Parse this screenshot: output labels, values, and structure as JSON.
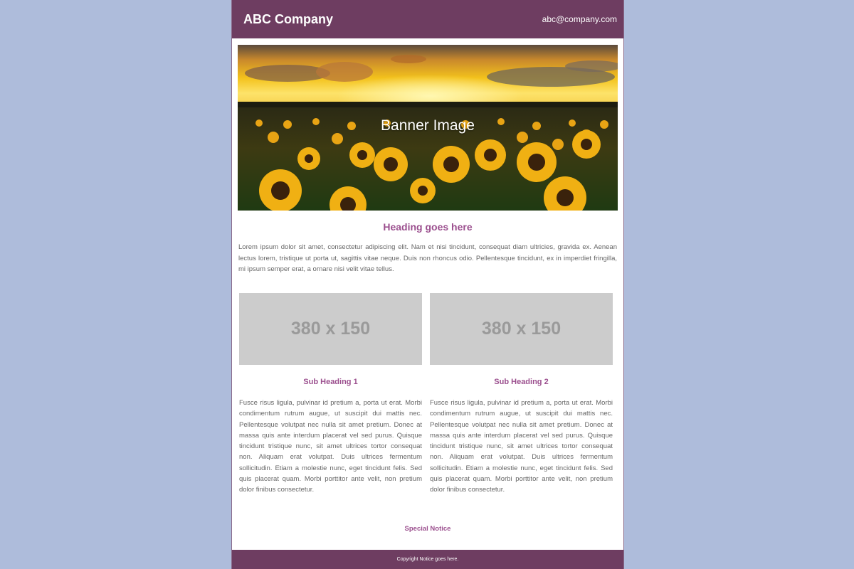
{
  "header": {
    "company": "ABC Company",
    "email": "abc@company.com"
  },
  "banner": {
    "label": "Banner Image"
  },
  "main": {
    "heading": "Heading goes here",
    "intro": "Lorem ipsum dolor sit amet, consectetur adipiscing elit. Nam et nisi tincidunt, consequat diam ultricies, gravida ex. Aenean lectus lorem, tristique ut porta ut, sagittis vitae neque. Duis non rhoncus odio. Pellentesque tincidunt, ex in imperdiet fringilla, mi ipsum semper erat, a ornare nisi velit vitae tellus."
  },
  "columns": [
    {
      "image_text": "380 x 150",
      "subheading": "Sub Heading 1",
      "text": "Fusce risus ligula, pulvinar id pretium a, porta ut erat. Morbi condimentum rutrum augue, ut suscipit dui mattis nec. Pellentesque volutpat nec nulla sit amet pretium. Donec at massa quis ante interdum placerat vel sed purus. Quisque tincidunt tristique nunc, sit amet ultrices tortor consequat non. Aliquam erat volutpat. Duis ultrices fermentum sollicitudin. Etiam a molestie nunc, eget tincidunt felis. Sed quis placerat quam. Morbi porttitor ante velit, non pretium dolor finibus consectetur."
    },
    {
      "image_text": "380 x 150",
      "subheading": "Sub Heading 2",
      "text": "Fusce risus ligula, pulvinar id pretium a, porta ut erat. Morbi condimentum rutrum augue, ut suscipit dui mattis nec. Pellentesque volutpat nec nulla sit amet pretium. Donec at massa quis ante interdum placerat vel sed purus. Quisque tincidunt tristique nunc, sit amet ultrices tortor consequat non. Aliquam erat volutpat. Duis ultrices fermentum sollicitudin. Etiam a molestie nunc, eget tincidunt felis. Sed quis placerat quam. Morbi porttitor ante velit, non pretium dolor finibus consectetur."
    }
  ],
  "notice": "Special Notice",
  "footer": {
    "copyright": "Copyright Notice goes here."
  },
  "colors": {
    "page_background": "#aebcdb",
    "header_background": "#6e3d61",
    "accent": "#9b4f8e",
    "placeholder": "#cccccc"
  }
}
